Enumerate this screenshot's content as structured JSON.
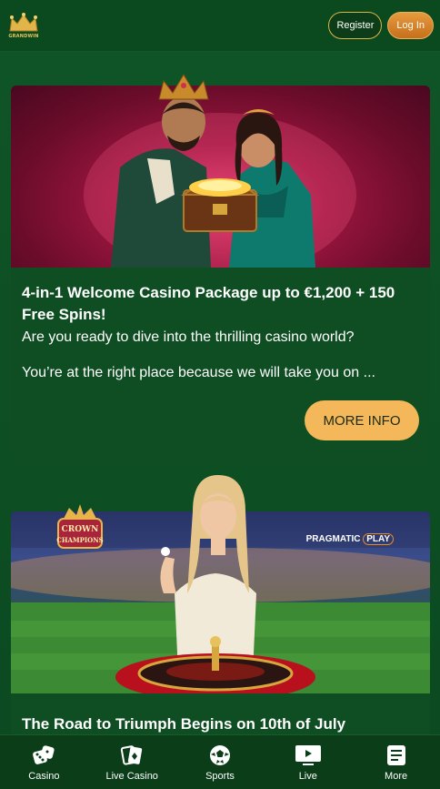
{
  "brand": {
    "logo_text": "GRANDWIN",
    "accent_gold": "#e7c25c",
    "background_green": "#0e4a22"
  },
  "header": {
    "register_label": "Register",
    "login_label": "Log In"
  },
  "promos": [
    {
      "title": "4-in-1 Welcome Casino Package up to €1,200 + 150 Free Spins!",
      "text_1": "Are you ready to dive into the thrilling casino world?",
      "text_2": "You’re at the right place because we will take you on ...",
      "button_label": "MORE INFO",
      "button_color": "#f4b85a"
    },
    {
      "title": "The Road to Triumph Begins on 10th of July",
      "badge_lines": [
        "CROWN",
        "CHAMPIONS"
      ],
      "provider_name": "PRAGMATIC",
      "provider_suffix": "PLAY"
    }
  ],
  "bottom_nav": [
    {
      "label": "Casino",
      "icon": "dice-icon"
    },
    {
      "label": "Live Casino",
      "icon": "cards-icon"
    },
    {
      "label": "Sports",
      "icon": "soccer-ball-icon"
    },
    {
      "label": "Live",
      "icon": "live-tv-icon"
    },
    {
      "label": "More",
      "icon": "menu-list-icon"
    }
  ]
}
